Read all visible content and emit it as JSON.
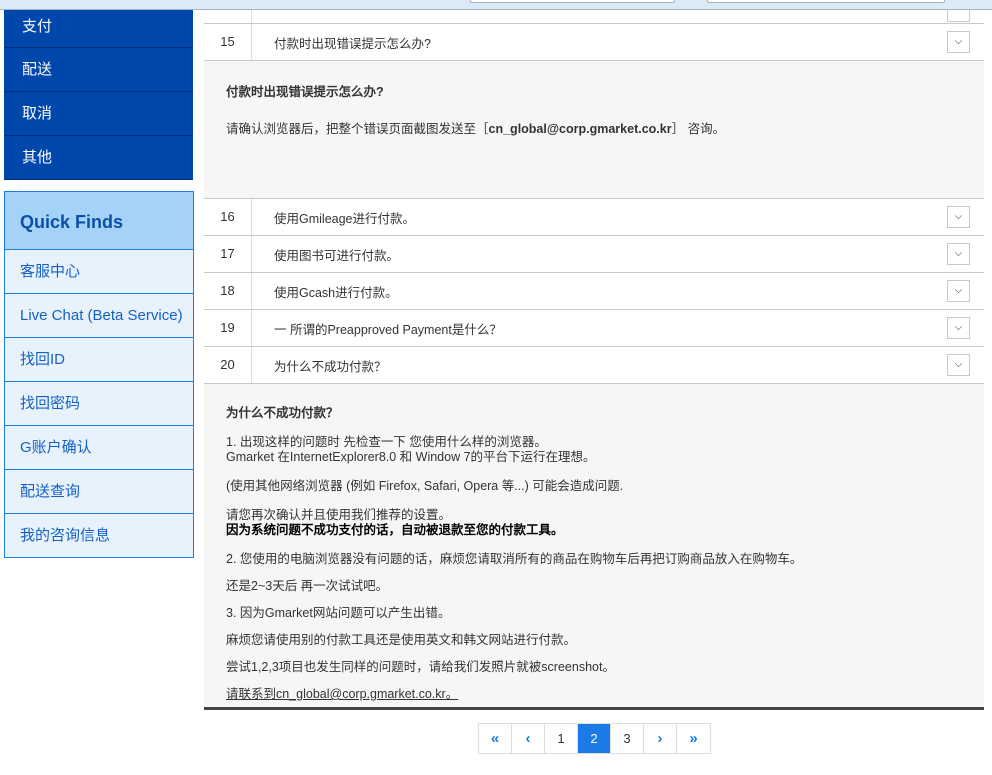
{
  "nav": {
    "items": [
      "支付",
      "配送",
      "取消",
      "其他"
    ]
  },
  "quick_finds": {
    "title": "Quick Finds",
    "items": [
      "客服中心",
      "Live Chat (Beta Service)",
      "找回ID",
      "找回密码",
      "G账户确认",
      "配送查询",
      "我的咨询信息"
    ]
  },
  "faq": {
    "row15": {
      "num": "15",
      "q": "付款时出现错误提示怎么办?"
    },
    "answer15": {
      "title": "付款时出现错误提示怎么办?",
      "text": "请确认浏览器后，把整个错误页面截图发送至［",
      "email": "cn_global@corp.gmarket.co.kr",
      "tail": "］ 咨询。"
    },
    "rows": [
      {
        "num": "16",
        "q": "使用Gmileage进行付款。"
      },
      {
        "num": "17",
        "q": "使用图书可进行付款。"
      },
      {
        "num": "18",
        "q": "使用Gcash进行付款。"
      },
      {
        "num": "19",
        "q": "一 所谓的Preapproved Payment是什么？"
      },
      {
        "num": "20",
        "q": "为什么不成功付款？"
      }
    ],
    "answer20": {
      "title": "为什么不成功付款？",
      "lines": [
        "1. 出现这样的问题时 先检查一下 您使用什么样的浏览器。",
        "Gmarket 在InternetExplorer8.0 和 Window 7的平台下运行在理想。",
        "(使用其他网络浏览器 (例如 Firefox, Safari, Opera 等...) 可能会造成问题.",
        "请您再次确认并且使用我们推荐的设置。",
        "因为系统问题不成功支付的话，自动被退款至您的付款工具。",
        "2. 您使用的电脑浏览器没有问题的话，麻烦您请取消所有的商品在购物车后再把订购商品放入在购物车。",
        "还是2~3天后 再一次试试吧。",
        "3. 因为Gmarket网站问题可以产生出错。",
        "麻烦您请使用别的付款工具还是使用英文和韩文网站进行付款。",
        "尝试1,2,3项目也发生同样的问题时，请给我们发照片就被screenshot。",
        "请联系到cn_global@corp.gmarket.co.kr。"
      ]
    }
  },
  "pagination": {
    "pages": [
      "1",
      "2",
      "3"
    ],
    "current": "2",
    "first": "«",
    "prev": "‹",
    "next": "›",
    "last": "»"
  },
  "colors": {
    "nav_bg": "#0047ab",
    "accent": "#1a7ae6",
    "qf_header": "#a5d3f7"
  }
}
